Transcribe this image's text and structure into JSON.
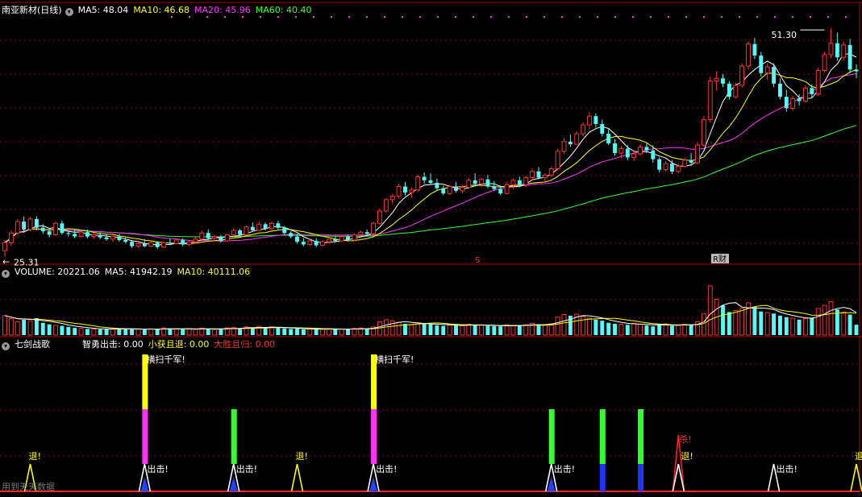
{
  "price_panel": {
    "title": "南亚新材(日线)",
    "ma_labels": [
      {
        "text": "MA5: 48.04",
        "color": "#ffffff"
      },
      {
        "text": "MA10: 46.68",
        "color": "#ffff00"
      },
      {
        "text": "MA20: 45.96",
        "color": "#ff33ff"
      },
      {
        "text": "MA60: 40.40",
        "color": "#33ff33"
      }
    ],
    "high_label": "51.30",
    "low_label": "25.31",
    "marker_s": "S",
    "marker_fin": "财",
    "marker_fin_prefix": "R"
  },
  "volume_panel": {
    "labels": [
      {
        "text": "VOLUME: 20221.06",
        "color": "#ffffff"
      },
      {
        "text": "MA5: 41942.19",
        "color": "#ffffff"
      },
      {
        "text": "MA10: 40111.06",
        "color": "#ffff00"
      }
    ]
  },
  "indicator_panel": {
    "title": "七剑战歌",
    "labels": [
      {
        "text": "智勇出击: 0.00",
        "color": "#ffffff"
      },
      {
        "text": "小获且退: 0.00",
        "color": "#ffff00"
      },
      {
        "text": "大胜且归: 0.00",
        "color": "#ff3333"
      }
    ],
    "signal_texts": {
      "sweep": "横扫千军!",
      "attack": "出击!",
      "retreat": "退!",
      "kill": "杀!"
    },
    "footer": "用到天天数据"
  },
  "colors": {
    "up": "#ff3333",
    "down": "#54fcfc",
    "ma5": "#ffffff",
    "ma10": "#ffff00",
    "ma20": "#ff33ff",
    "ma60": "#33ff33",
    "grid": "#8b0000"
  },
  "chart_data": [
    {
      "type": "candlestick",
      "title": "南亚新材(日线)",
      "ylim": [
        25.0,
        52.5
      ],
      "ohlc": [
        [
          26.0,
          27.2,
          25.3,
          26.9
        ],
        [
          26.9,
          28.3,
          26.5,
          28.0
        ],
        [
          28.0,
          29.6,
          27.8,
          29.3
        ],
        [
          29.3,
          29.9,
          28.0,
          28.4
        ],
        [
          28.4,
          29.8,
          28.2,
          29.6
        ],
        [
          29.6,
          29.9,
          28.3,
          28.6
        ],
        [
          28.6,
          29.0,
          27.9,
          28.2
        ],
        [
          28.2,
          28.6,
          27.5,
          27.8
        ],
        [
          27.8,
          29.3,
          27.7,
          29.1
        ],
        [
          29.1,
          29.4,
          27.8,
          28.0
        ],
        [
          28.0,
          28.3,
          27.6,
          27.9
        ],
        [
          27.9,
          28.4,
          27.4,
          27.6
        ],
        [
          27.6,
          28.3,
          27.5,
          28.1
        ],
        [
          28.1,
          28.4,
          27.4,
          27.6
        ],
        [
          27.6,
          28.0,
          27.3,
          27.8
        ],
        [
          27.8,
          28.1,
          27.3,
          27.5
        ],
        [
          27.5,
          27.9,
          27.1,
          27.3
        ],
        [
          27.3,
          27.8,
          27.0,
          27.6
        ],
        [
          27.6,
          27.9,
          27.0,
          27.2
        ],
        [
          27.2,
          27.5,
          26.8,
          27.0
        ],
        [
          27.0,
          27.2,
          26.3,
          26.5
        ],
        [
          26.5,
          27.0,
          26.3,
          26.8
        ],
        [
          26.8,
          27.3,
          26.4,
          26.5
        ],
        [
          26.5,
          27.1,
          26.4,
          26.9
        ],
        [
          26.9,
          27.1,
          26.2,
          26.4
        ],
        [
          26.4,
          27.0,
          26.3,
          26.9
        ],
        [
          26.9,
          27.4,
          26.6,
          26.8
        ],
        [
          26.8,
          27.4,
          26.7,
          27.2
        ],
        [
          27.2,
          27.4,
          26.5,
          26.7
        ],
        [
          26.7,
          27.1,
          26.5,
          27.0
        ],
        [
          27.0,
          27.5,
          26.8,
          27.3
        ],
        [
          27.3,
          28.3,
          27.1,
          28.0
        ],
        [
          28.0,
          28.4,
          27.2,
          27.4
        ],
        [
          27.4,
          27.8,
          27.1,
          27.6
        ],
        [
          27.6,
          27.8,
          26.9,
          27.1
        ],
        [
          27.1,
          27.9,
          27.0,
          27.8
        ],
        [
          27.8,
          28.6,
          27.6,
          28.3
        ],
        [
          28.3,
          28.5,
          27.6,
          27.8
        ],
        [
          27.8,
          28.9,
          27.7,
          28.7
        ],
        [
          28.7,
          29.2,
          28.1,
          28.3
        ],
        [
          28.3,
          29.3,
          28.2,
          29.0
        ],
        [
          29.0,
          29.2,
          28.3,
          28.5
        ],
        [
          28.5,
          29.3,
          28.3,
          29.1
        ],
        [
          29.1,
          29.4,
          28.4,
          28.6
        ],
        [
          28.6,
          28.8,
          27.8,
          28.0
        ],
        [
          28.0,
          28.2,
          27.4,
          27.6
        ],
        [
          27.6,
          27.9,
          26.8,
          27.0
        ],
        [
          27.0,
          27.4,
          26.5,
          26.7
        ],
        [
          26.7,
          27.3,
          26.5,
          27.1
        ],
        [
          27.1,
          27.4,
          26.4,
          26.6
        ],
        [
          26.6,
          27.2,
          26.5,
          27.0
        ],
        [
          27.0,
          27.5,
          26.8,
          27.3
        ],
        [
          27.3,
          27.6,
          26.9,
          27.1
        ],
        [
          27.1,
          27.8,
          27.0,
          27.6
        ],
        [
          27.6,
          27.8,
          27.0,
          27.2
        ],
        [
          27.2,
          28.0,
          27.1,
          27.8
        ],
        [
          27.8,
          28.3,
          27.6,
          28.1
        ],
        [
          28.1,
          28.4,
          27.7,
          27.9
        ],
        [
          27.9,
          29.3,
          27.8,
          29.1
        ],
        [
          29.1,
          30.8,
          28.9,
          30.5
        ],
        [
          30.5,
          32.0,
          30.3,
          31.8
        ],
        [
          31.8,
          32.4,
          31.3,
          32.2
        ],
        [
          32.2,
          33.6,
          31.9,
          33.3
        ],
        [
          33.3,
          33.8,
          32.3,
          32.6
        ],
        [
          32.6,
          33.2,
          32.0,
          32.9
        ],
        [
          32.9,
          34.6,
          32.7,
          34.4
        ],
        [
          34.4,
          34.9,
          33.6,
          34.0
        ],
        [
          34.0,
          34.8,
          33.5,
          33.7
        ],
        [
          33.7,
          34.2,
          32.9,
          33.1
        ],
        [
          33.1,
          33.4,
          32.3,
          32.5
        ],
        [
          32.5,
          33.5,
          32.3,
          33.3
        ],
        [
          33.3,
          33.8,
          32.6,
          32.8
        ],
        [
          32.8,
          33.5,
          32.5,
          33.2
        ],
        [
          33.2,
          34.3,
          33.0,
          34.0
        ],
        [
          34.0,
          34.8,
          33.3,
          33.6
        ],
        [
          33.6,
          34.3,
          33.2,
          34.1
        ],
        [
          34.1,
          34.6,
          33.1,
          33.3
        ],
        [
          33.3,
          33.9,
          32.8,
          33.0
        ],
        [
          33.0,
          33.4,
          32.3,
          32.5
        ],
        [
          32.5,
          33.8,
          32.4,
          33.5
        ],
        [
          33.5,
          34.2,
          33.0,
          34.0
        ],
        [
          34.0,
          34.4,
          33.2,
          33.5
        ],
        [
          33.5,
          34.5,
          33.2,
          34.3
        ],
        [
          34.3,
          35.3,
          34.0,
          35.0
        ],
        [
          35.0,
          35.5,
          34.1,
          34.3
        ],
        [
          34.3,
          34.8,
          33.9,
          34.6
        ],
        [
          34.6,
          35.6,
          34.4,
          35.3
        ],
        [
          35.3,
          37.6,
          35.1,
          37.3
        ],
        [
          37.3,
          38.8,
          37.0,
          38.4
        ],
        [
          38.4,
          39.2,
          37.8,
          38.1
        ],
        [
          38.1,
          39.6,
          38.0,
          39.3
        ],
        [
          39.3,
          40.6,
          39.0,
          40.3
        ],
        [
          40.3,
          41.8,
          39.8,
          41.3
        ],
        [
          41.3,
          41.6,
          40.0,
          40.4
        ],
        [
          40.4,
          40.9,
          39.0,
          39.3
        ],
        [
          39.3,
          39.8,
          38.0,
          38.2
        ],
        [
          38.2,
          38.7,
          36.8,
          37.1
        ],
        [
          37.1,
          37.9,
          36.5,
          37.6
        ],
        [
          37.6,
          38.0,
          36.3,
          36.6
        ],
        [
          36.6,
          37.3,
          36.2,
          37.0
        ],
        [
          37.0,
          38.1,
          36.8,
          37.8
        ],
        [
          37.8,
          38.3,
          37.1,
          37.4
        ],
        [
          37.4,
          38.0,
          36.0,
          36.4
        ],
        [
          36.4,
          36.6,
          34.9,
          35.2
        ],
        [
          35.2,
          36.2,
          35.0,
          35.9
        ],
        [
          35.9,
          36.3,
          34.7,
          35.0
        ],
        [
          35.0,
          35.9,
          34.8,
          35.6
        ],
        [
          35.6,
          36.6,
          35.4,
          36.3
        ],
        [
          36.3,
          37.1,
          35.6,
          36.0
        ],
        [
          36.0,
          38.3,
          35.8,
          38.0
        ],
        [
          38.0,
          41.3,
          37.8,
          40.9
        ],
        [
          40.9,
          45.8,
          40.6,
          45.3
        ],
        [
          45.3,
          46.4,
          44.2,
          45.6
        ],
        [
          45.6,
          46.1,
          44.6,
          45.0
        ],
        [
          45.0,
          45.3,
          43.2,
          43.5
        ],
        [
          43.5,
          45.1,
          43.3,
          44.8
        ],
        [
          44.8,
          47.3,
          44.5,
          47.0
        ],
        [
          47.0,
          49.8,
          46.6,
          49.5
        ],
        [
          49.5,
          50.2,
          47.8,
          48.2
        ],
        [
          48.2,
          48.6,
          45.8,
          46.2
        ],
        [
          46.2,
          47.3,
          45.4,
          46.9
        ],
        [
          46.9,
          47.3,
          44.6,
          45.0
        ],
        [
          45.0,
          45.6,
          43.2,
          43.5
        ],
        [
          43.5,
          44.3,
          41.8,
          42.2
        ],
        [
          42.2,
          43.6,
          41.9,
          43.3
        ],
        [
          43.3,
          43.8,
          42.5,
          43.0
        ],
        [
          43.0,
          44.8,
          42.8,
          44.5
        ],
        [
          44.5,
          44.9,
          43.4,
          43.8
        ],
        [
          43.8,
          46.8,
          43.6,
          46.5
        ],
        [
          46.5,
          48.6,
          46.3,
          48.3
        ],
        [
          48.3,
          51.3,
          47.9,
          49.6
        ],
        [
          49.6,
          50.8,
          47.6,
          48.0
        ],
        [
          48.0,
          49.8,
          47.6,
          49.4
        ],
        [
          49.4,
          50.1,
          46.2,
          46.6
        ],
        [
          46.6,
          47.2,
          45.6,
          46.4
        ]
      ],
      "ma_values": {
        "MA5": 48.04,
        "MA10": 46.68,
        "MA20": 45.96,
        "MA60": 40.4
      },
      "annotations": [
        {
          "label": "51.30",
          "kind": "high"
        },
        {
          "label": "25.31",
          "kind": "low"
        }
      ]
    },
    {
      "type": "bar",
      "title": "VOLUME",
      "ylim": [
        0,
        110000
      ],
      "values": [
        38000,
        32000,
        26000,
        30000,
        28000,
        33000,
        24000,
        21000,
        19000,
        18000,
        16000,
        14000,
        13000,
        12000,
        11500,
        11000,
        12000,
        12500,
        11000,
        13000,
        12000,
        11500,
        11000,
        12000,
        11000,
        14000,
        13000,
        12000,
        11500,
        12500,
        11000,
        13500,
        12000,
        11000,
        12500,
        14000,
        15000,
        13000,
        16000,
        14000,
        17000,
        15000,
        16000,
        14000,
        13000,
        12000,
        12500,
        11000,
        12000,
        11000,
        11500,
        12500,
        11000,
        12000,
        11500,
        13000,
        14000,
        12000,
        16000,
        26000,
        30000,
        28000,
        25000,
        22000,
        20000,
        24000,
        22000,
        21000,
        19000,
        18000,
        20000,
        19000,
        18500,
        21000,
        19000,
        20000,
        18000,
        17500,
        17000,
        20000,
        19000,
        18000,
        20500,
        23000,
        21000,
        20000,
        22000,
        35000,
        40000,
        38000,
        41000,
        36000,
        33000,
        30000,
        28000,
        24000,
        22000,
        21000,
        20000,
        23000,
        21000,
        19000,
        17000,
        20000,
        22000,
        18000,
        19000,
        21000,
        20000,
        26000,
        42000,
        96000,
        70000,
        58000,
        45000,
        48000,
        52000,
        63000,
        55000,
        46000,
        44000,
        42000,
        38000,
        35000,
        33000,
        30000,
        32000,
        34000,
        52000,
        58000,
        65000,
        50000,
        45000,
        40000,
        20221
      ],
      "ma_values": {
        "VOLUME": 20221.06,
        "MA5": 41942.19,
        "MA10": 40111.06
      }
    },
    {
      "type": "bar",
      "title": "七剑战歌",
      "values_latest": {
        "智勇出击": 0.0,
        "小获且退": 0.0,
        "大胜且归": 0.0
      },
      "signals": [
        {
          "i": 4,
          "kind": "retreat"
        },
        {
          "i": 22,
          "kind": "sweep"
        },
        {
          "i": 36,
          "kind": "green-attack"
        },
        {
          "i": 46,
          "kind": "retreat"
        },
        {
          "i": 58,
          "kind": "sweep"
        },
        {
          "i": 86,
          "kind": "green-attack"
        },
        {
          "i": 94,
          "kind": "green-solid"
        },
        {
          "i": 100,
          "kind": "green-solid"
        },
        {
          "i": 106,
          "kind": "kill-retreat"
        },
        {
          "i": 121,
          "kind": "attack-white"
        },
        {
          "i": 134,
          "kind": "retreat"
        },
        {
          "i": 137,
          "kind": "sweep"
        },
        {
          "i": 146,
          "kind": "kill-retreat"
        }
      ]
    }
  ]
}
